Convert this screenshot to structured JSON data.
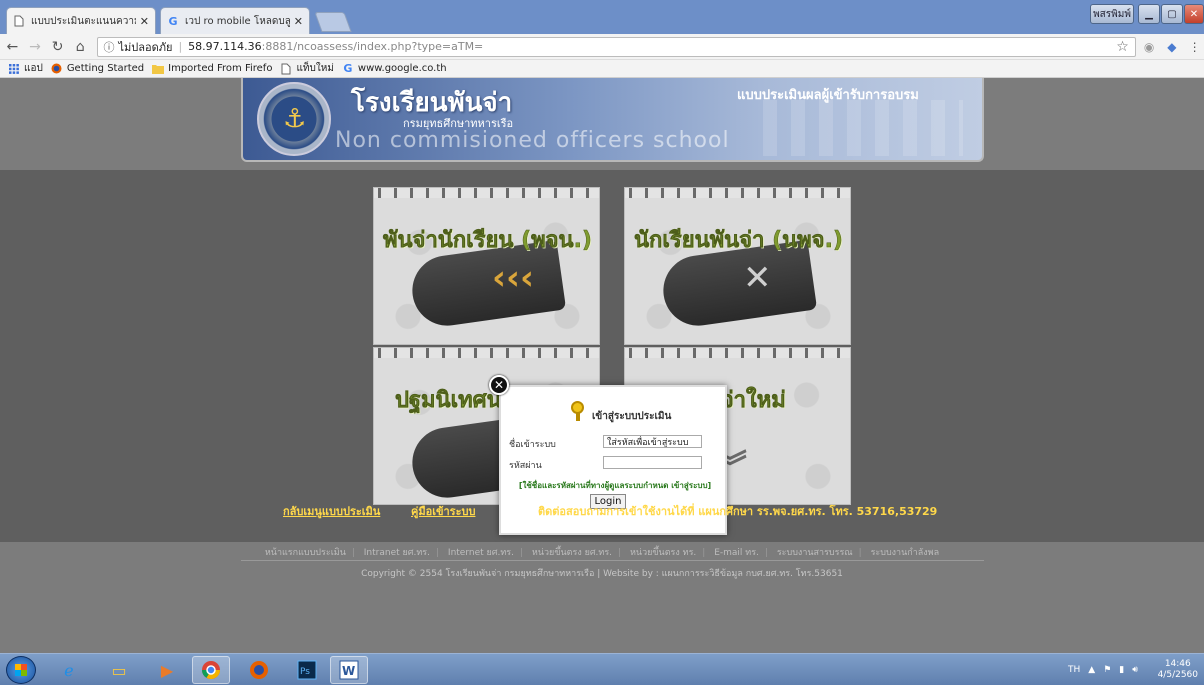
{
  "browser": {
    "tabs": [
      {
        "title": "แบบประเมินตะแนนความพ",
        "icon": "page-icon",
        "active": true
      },
      {
        "title": "เวป ro mobile โหลดบลูสแ",
        "icon": "google-icon",
        "active": false
      }
    ],
    "window_user_label": "พสรพิมพ์",
    "address": {
      "security_label": "ไม่ปลอดภัย",
      "host": "58.97.114.36",
      "path": ":8881/ncoassess/index.php?type=aTM="
    },
    "bookmarks": [
      {
        "label": "แอป",
        "icon": "apps-grid-icon"
      },
      {
        "label": "Getting Started",
        "icon": "firefox-icon"
      },
      {
        "label": "Imported From Firefo",
        "icon": "folder-icon"
      },
      {
        "label": "แท็บใหม่",
        "icon": "page-icon"
      },
      {
        "label": "www.google.co.th",
        "icon": "google-icon"
      }
    ]
  },
  "banner": {
    "school_th": "โรงเรียนพันจ่า",
    "department_th": "กรมยุทธศึกษาทหารเรือ",
    "school_en": "Non commisioned officers school",
    "eval_title": "แบบประเมินผลผู้เข้ารับการอบรม"
  },
  "cards": [
    {
      "title": "พันจ่านักเรียน (พจน.)"
    },
    {
      "title": "นักเรียนพันจ่า (นพจ.)"
    },
    {
      "title": "ปฐมนิเทศนายทหาร"
    },
    {
      "title": "พันจ่าใหม่"
    }
  ],
  "login": {
    "title": "เข้าสู่ระบบประเมิน",
    "username_label": "ชื่อเข้าระบบ",
    "username_value": "ใส่รหัสเพื่อเข้าสู่ระบบ",
    "password_label": "รหัสผ่าน",
    "password_value": "",
    "hint": "[ใช้ชื่อและรหัสผ่านที่ทางผู้ดูแลระบบกำหนด เข้าสู่ระบบ]",
    "button_label": "Login"
  },
  "page_links": {
    "back_menu": "กลับเมนูแบบประเมิน",
    "manual": "คู่มือเข้าระบบ",
    "contact": "ติดต่อสอบถามการเข้าใช้งานได้ที่ แผนกศึกษา รร.พจ.ยศ.ทร. โทร. 53716,53729"
  },
  "footer": {
    "links": [
      "หน้าแรกแบบประเมิน",
      "Intranet ยศ.ทร.",
      "Internet ยศ.ทร.",
      "หน่วยขึ้นตรง ยศ.ทร.",
      "หน่วยขึ้นตรง ทร.",
      "E-mail ทร.",
      "ระบบงานสารบรรณ",
      "ระบบงานกำลังพล"
    ],
    "copyright": "Copyright © 2554 โรงเรียนพันจ่า กรมยุทธศึกษาทหารเรือ | Website by : แผนกการระวิธีข้อมูล กบศ.ยศ.ทร. โทร.53651"
  },
  "taskbar": {
    "language": "TH",
    "time": "14:46",
    "date": "4/5/2560"
  }
}
